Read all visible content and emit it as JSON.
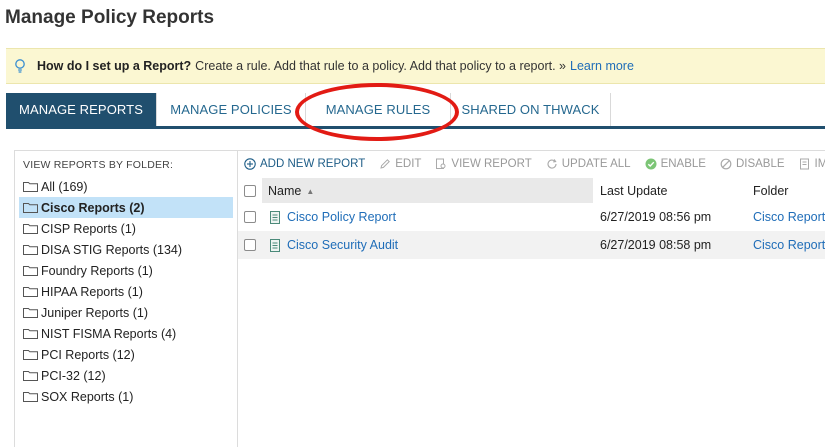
{
  "page": {
    "title": "Manage Policy Reports"
  },
  "hint": {
    "question": "How do I set up a Report?",
    "text": "Create a rule. Add that rule to a policy. Add that policy to a report. »",
    "link": "Learn more"
  },
  "tabs": [
    {
      "label": "MANAGE REPORTS",
      "active": true
    },
    {
      "label": "MANAGE POLICIES",
      "active": false
    },
    {
      "label": "MANAGE RULES",
      "active": false
    },
    {
      "label": "SHARED ON THWACK",
      "active": false
    }
  ],
  "annotation": {
    "shape": "ellipse",
    "color": "#e21b14",
    "target": "MANAGE RULES"
  },
  "folders": {
    "header": "VIEW REPORTS BY FOLDER:",
    "items": [
      {
        "label": "All (169)",
        "selected": false
      },
      {
        "label": "Cisco Reports (2)",
        "selected": true
      },
      {
        "label": "CISP Reports (1)",
        "selected": false
      },
      {
        "label": "DISA STIG Reports (134)",
        "selected": false
      },
      {
        "label": "Foundry Reports (1)",
        "selected": false
      },
      {
        "label": "HIPAA Reports (1)",
        "selected": false
      },
      {
        "label": "Juniper Reports (1)",
        "selected": false
      },
      {
        "label": "NIST FISMA Reports (4)",
        "selected": false
      },
      {
        "label": "PCI Reports (12)",
        "selected": false
      },
      {
        "label": "PCI-32 (12)",
        "selected": false
      },
      {
        "label": "SOX Reports (1)",
        "selected": false
      }
    ]
  },
  "toolbar": {
    "add": "ADD NEW REPORT",
    "edit": "EDIT",
    "view": "VIEW REPORT",
    "update": "UPDATE ALL",
    "enable": "ENABLE",
    "disable": "DISABLE",
    "more": "IM"
  },
  "grid": {
    "columns": {
      "name": "Name",
      "update": "Last Update",
      "folder": "Folder"
    },
    "rows": [
      {
        "name": "Cisco Policy Report",
        "update": "6/27/2019 08:56 pm",
        "folder": "Cisco Reports"
      },
      {
        "name": "Cisco Security Audit",
        "update": "6/27/2019 08:58 pm",
        "folder": "Cisco Reports"
      }
    ]
  },
  "colors": {
    "accent": "#204f6e",
    "link": "#1f6db8",
    "selected": "#c2e2f8",
    "hint_bg": "#fbf7d2"
  }
}
